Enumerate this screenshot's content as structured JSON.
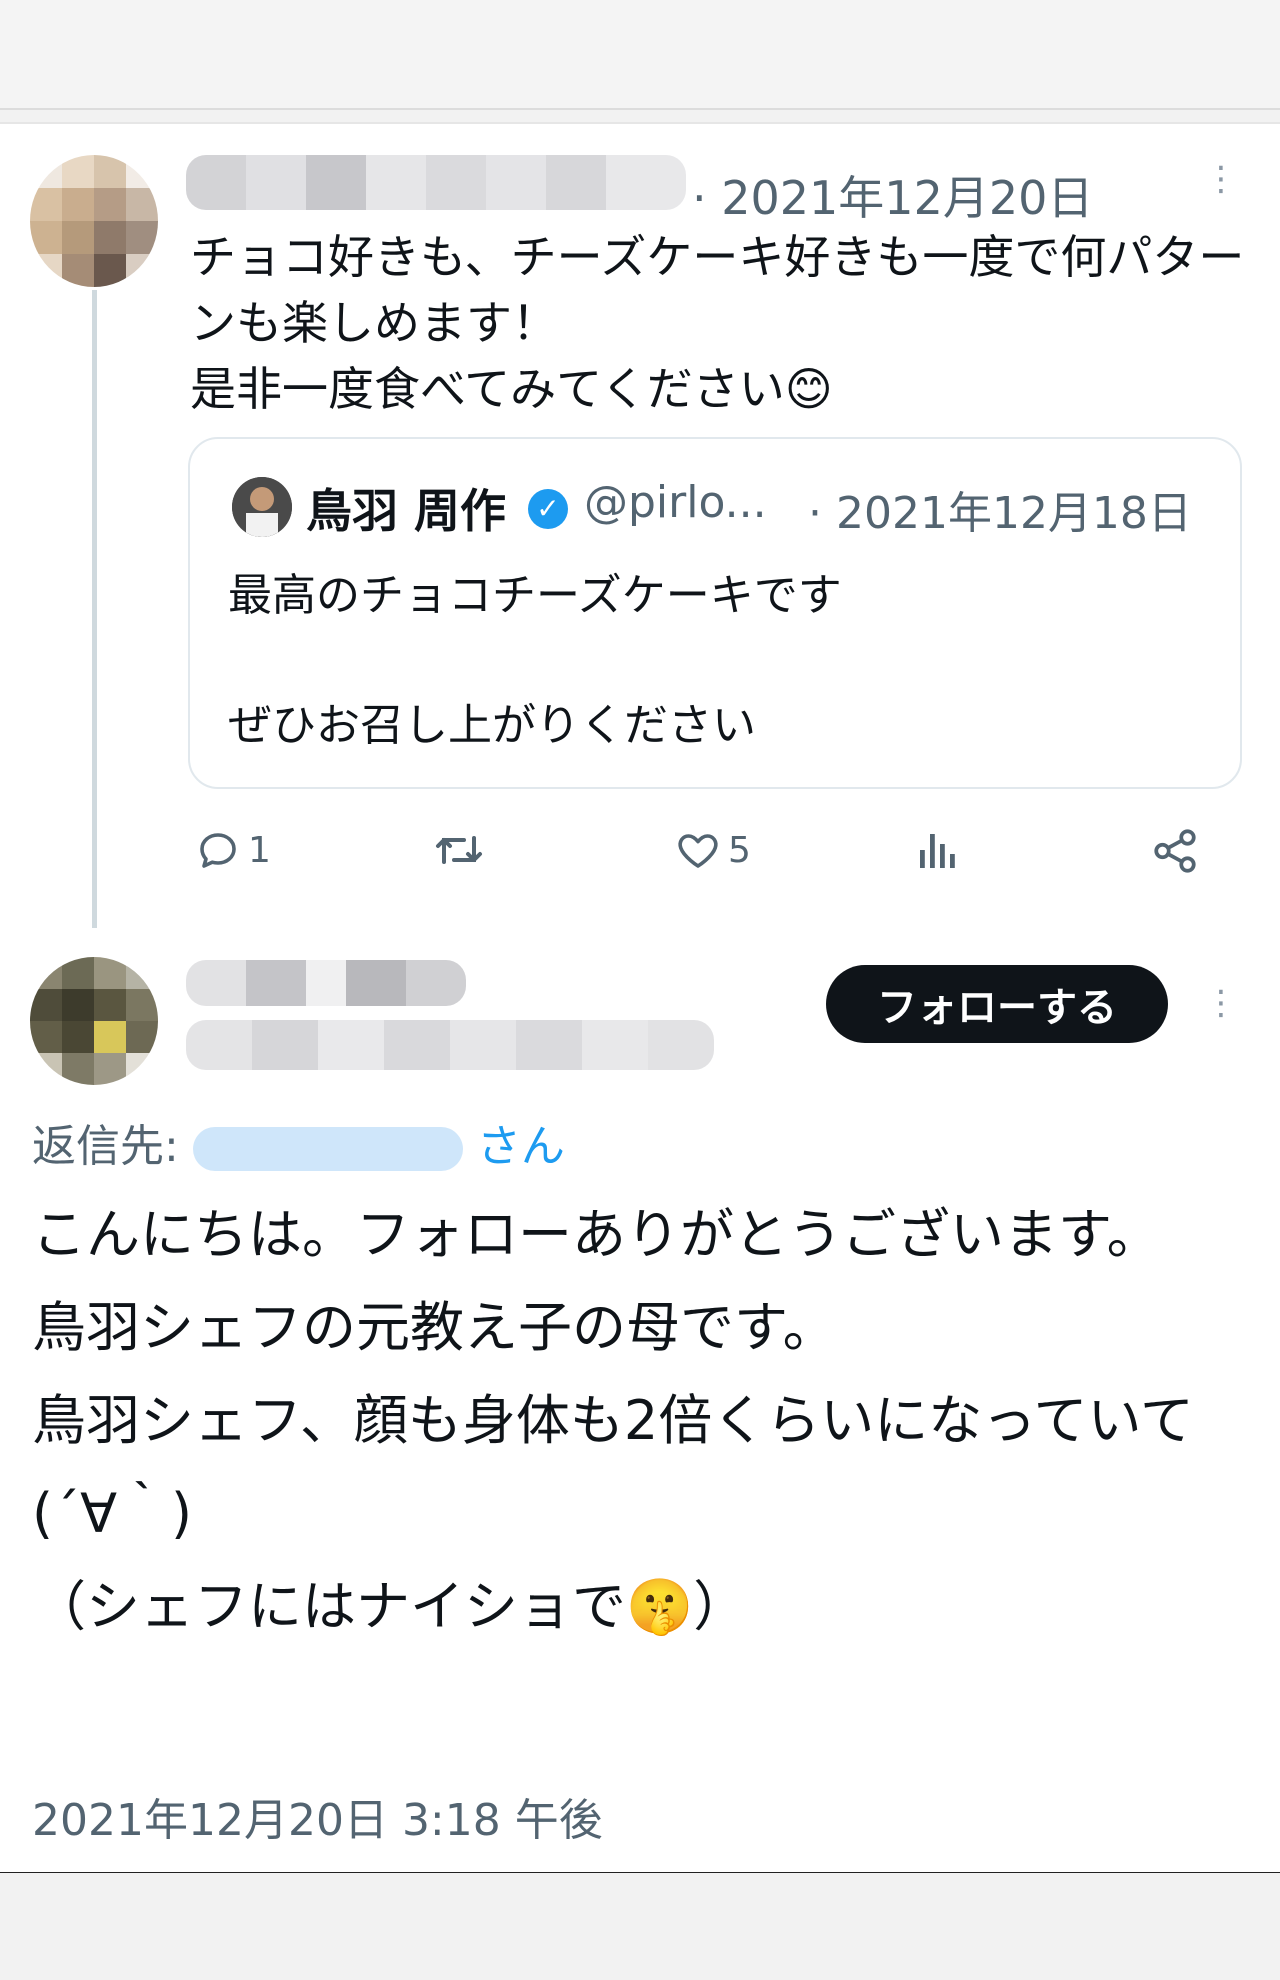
{
  "tweet": {
    "date": "· 2021年12月20日",
    "text": "チョコ好きも、チーズケーキ好きも一度で何パターンも楽しめます！\n是非一度食べてみてください😊",
    "more_icon": "more-vertical-icon"
  },
  "quote": {
    "name": "鳥羽 周作",
    "verified_icon": "verified-badge-icon",
    "handle": "@pirlo...",
    "date": "· 2021年12月18日",
    "text_line1": "最高のチョコチーズケーキです",
    "text_line2": "ぜひお召し上がりください"
  },
  "actions": {
    "reply_count": "1",
    "retweet_count": "",
    "like_count": "5",
    "icons": [
      "reply-icon",
      "retweet-icon",
      "like-icon",
      "views-icon",
      "share-icon"
    ]
  },
  "reply": {
    "follow_label": "フォローする",
    "reply_to_prefix": "返信先:",
    "reply_to_suffix": "さん",
    "text": "こんにちは。フォローありがとうございます。\n鳥羽シェフの元教え子の母です。\n鳥羽シェフ、顔も身体も2倍くらいになっていて(´∀｀)\n（シェフにはナイショで🤫）",
    "timestamp": "2021年12月20日 3:18 午後"
  },
  "colors": {
    "text": "#0f1419",
    "secondary": "#536471",
    "link": "#1d9bf0",
    "button": "#0f1419"
  }
}
